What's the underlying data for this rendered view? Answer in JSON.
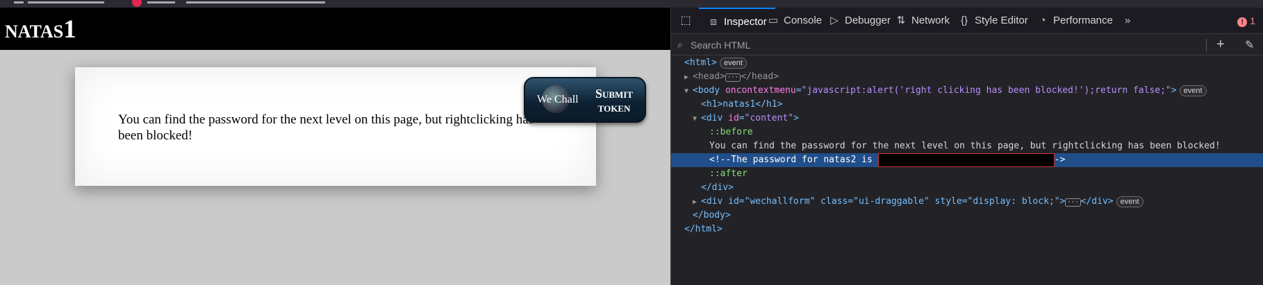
{
  "page": {
    "site_title": "natas1",
    "content_text": "You can find the password for the next level on this page, but rightclicking has been blocked!",
    "wechall_logo": "We Chall",
    "wechall_submit": "Submit token"
  },
  "devtools": {
    "tabs": [
      {
        "label": "Inspector",
        "icon": "inspector-icon"
      },
      {
        "label": "Console",
        "icon": "console-icon"
      },
      {
        "label": "Debugger",
        "icon": "debugger-icon"
      },
      {
        "label": "Network",
        "icon": "network-icon"
      },
      {
        "label": "Style Editor",
        "icon": "style-editor-icon"
      },
      {
        "label": "Performance",
        "icon": "performance-icon"
      }
    ],
    "error_count": "1",
    "search_placeholder": "Search HTML",
    "badges": {
      "event": "event"
    },
    "markup": {
      "html_open": "<html>",
      "head": "<head>",
      "head_close": "</head>",
      "body_attr": "oncontextmenu",
      "body_val": "\"javascript:alert('right clicking has been blocked!');return false;\"",
      "h1": "<h1>natas1</h1>",
      "div_content_attr": "id",
      "div_content_val": "\"content\"",
      "before": "::before",
      "text_node": "You can find the password for the next level on this page, but rightclicking has been blocked!",
      "comment_prefix": "<!--The password for natas2 is ",
      "comment_suffix": "->",
      "after": "::after",
      "div_close": "</div>",
      "wechall_div": "<div id=\"wechallform\" class=\"ui-draggable\" style=\"display: block;\">",
      "wechall_close": "</div>",
      "body_close": "</body>",
      "html_close": "</html>"
    }
  }
}
